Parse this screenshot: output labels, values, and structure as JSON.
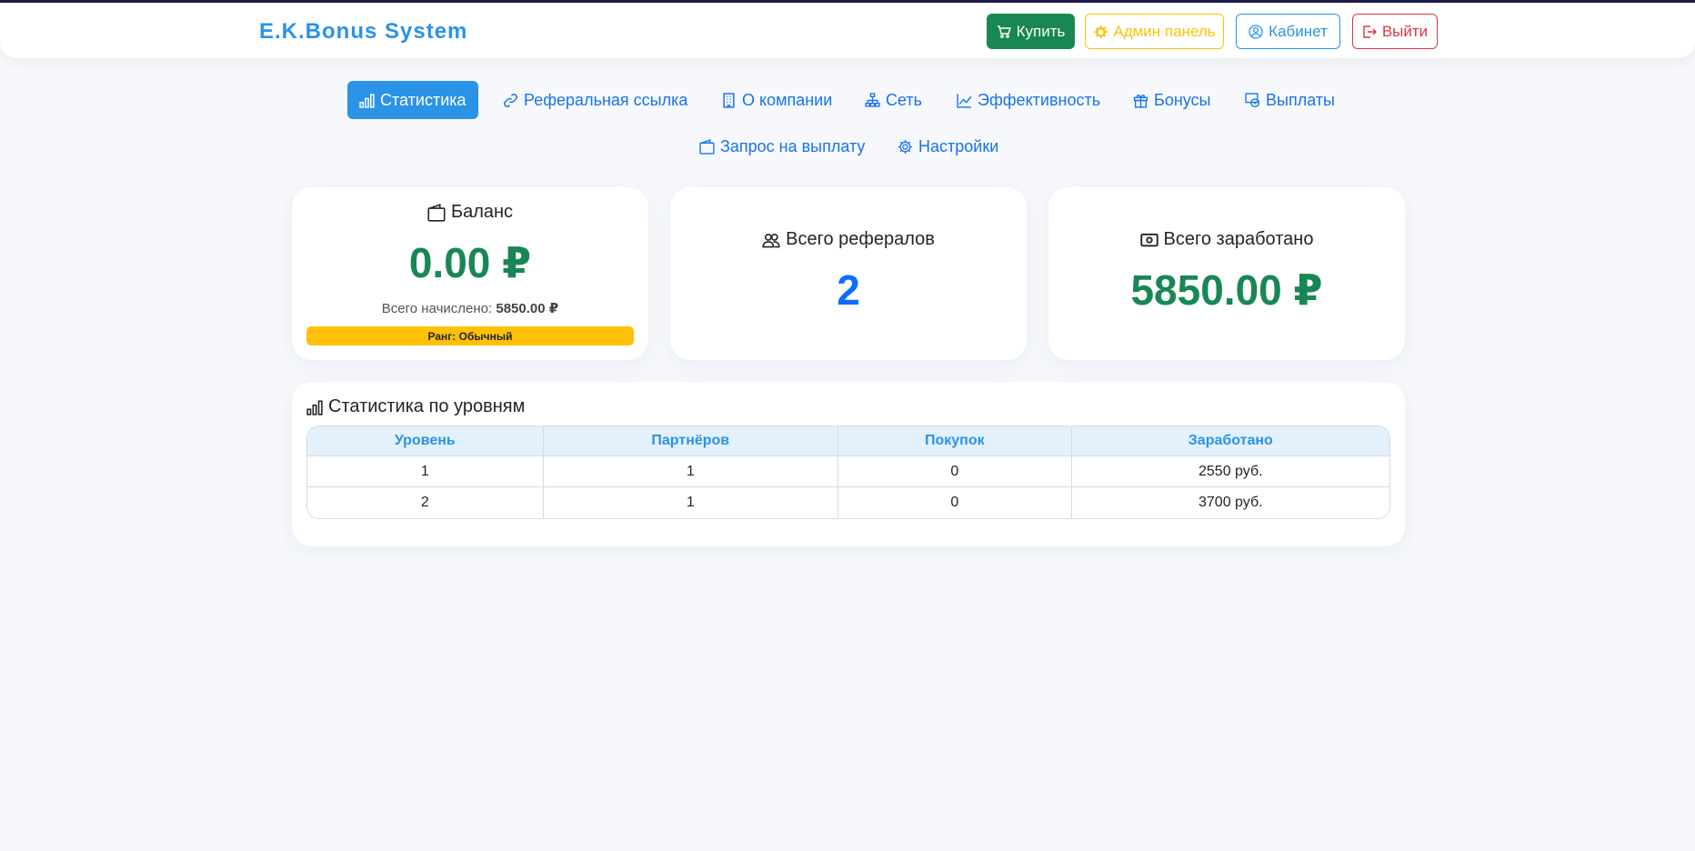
{
  "navbar": {
    "brand": "E.K.Bonus System",
    "buy_label": "Купить",
    "admin_label": "Админ панель",
    "cabinet_label": "Кабинет",
    "logout_label": "Выйти"
  },
  "tabs": [
    {
      "label": "Статистика",
      "icon": "bar-chart-icon",
      "active": true
    },
    {
      "label": "Реферальная ссылка",
      "icon": "link-icon"
    },
    {
      "label": "О компании",
      "icon": "building-icon"
    },
    {
      "label": "Сеть",
      "icon": "network-icon"
    },
    {
      "label": "Эффективность",
      "icon": "graph-up-icon"
    },
    {
      "label": "Бонусы",
      "icon": "gift-icon"
    },
    {
      "label": "Выплаты",
      "icon": "cash-coin-icon"
    },
    {
      "label": "Запрос на выплату",
      "icon": "wallet-icon"
    },
    {
      "label": "Настройки",
      "icon": "gear-icon"
    }
  ],
  "balance_card": {
    "title": "Баланс",
    "value": "0.00 ₽",
    "accrued_label": "Всего начислено:",
    "accrued_value": "5850.00 ₽",
    "rank": "Ранг: Обычный"
  },
  "referrals_card": {
    "title": "Всего рефералов",
    "value": "2"
  },
  "earned_card": {
    "title": "Всего заработано",
    "value": "5850.00 ₽"
  },
  "levels": {
    "title": "Статистика по уровням",
    "columns": [
      "Уровень",
      "Партнёров",
      "Покупок",
      "Заработано"
    ],
    "rows": [
      [
        "1",
        "1",
        "0",
        "2550 руб."
      ],
      [
        "2",
        "1",
        "0",
        "3700 руб."
      ]
    ]
  },
  "colors": {
    "accent": "#2b93e6",
    "success": "#198754",
    "warning": "#ffc107",
    "danger": "#dc3545",
    "primary": "#0d6efd"
  }
}
